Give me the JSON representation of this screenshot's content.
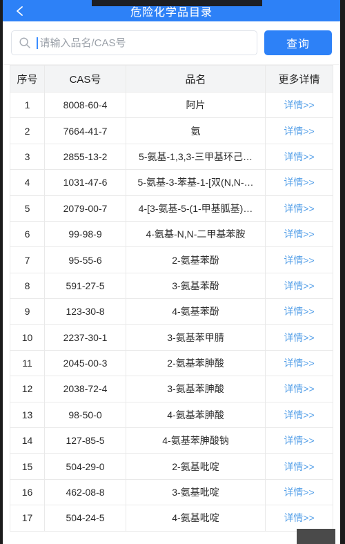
{
  "header": {
    "title": "危险化学品目录",
    "back_icon": "chevron-left-icon",
    "bg_color": "#2d81f7"
  },
  "search": {
    "icon": "search-icon",
    "placeholder": "请输入品名/CAS号",
    "value": "",
    "button_label": "查询",
    "button_color": "#2d81f7"
  },
  "table": {
    "columns": [
      "序号",
      "CAS号",
      "品名",
      "更多详情"
    ],
    "detail_label": "详情>>",
    "link_color": "#56a0e8",
    "rows": [
      {
        "idx": "1",
        "cas": "8008-60-4",
        "name": "阿片"
      },
      {
        "idx": "2",
        "cas": "7664-41-7",
        "name": "氨"
      },
      {
        "idx": "3",
        "cas": "2855-13-2",
        "name": "5-氨基-1,3,3-三甲基环己…"
      },
      {
        "idx": "4",
        "cas": "1031-47-6",
        "name": "5-氨基-3-苯基-1-[双(N,N-…"
      },
      {
        "idx": "5",
        "cas": "2079-00-7",
        "name": "4-[3-氨基-5-(1-甲基胍基)…"
      },
      {
        "idx": "6",
        "cas": "99-98-9",
        "name": "4-氨基-N,N-二甲基苯胺"
      },
      {
        "idx": "7",
        "cas": "95-55-6",
        "name": "2-氨基苯酚"
      },
      {
        "idx": "8",
        "cas": "591-27-5",
        "name": "3-氨基苯酚"
      },
      {
        "idx": "9",
        "cas": "123-30-8",
        "name": "4-氨基苯酚"
      },
      {
        "idx": "10",
        "cas": "2237-30-1",
        "name": "3-氨基苯甲腈"
      },
      {
        "idx": "11",
        "cas": "2045-00-3",
        "name": "2-氨基苯胂酸"
      },
      {
        "idx": "12",
        "cas": "2038-72-4",
        "name": "3-氨基苯胂酸"
      },
      {
        "idx": "13",
        "cas": "98-50-0",
        "name": "4-氨基苯胂酸"
      },
      {
        "idx": "14",
        "cas": "127-85-5",
        "name": "4-氨基苯胂酸钠"
      },
      {
        "idx": "15",
        "cas": "504-29-0",
        "name": "2-氨基吡啶"
      },
      {
        "idx": "16",
        "cas": "462-08-8",
        "name": "3-氨基吡啶"
      },
      {
        "idx": "17",
        "cas": "504-24-5",
        "name": "4-氨基吡啶"
      }
    ]
  }
}
